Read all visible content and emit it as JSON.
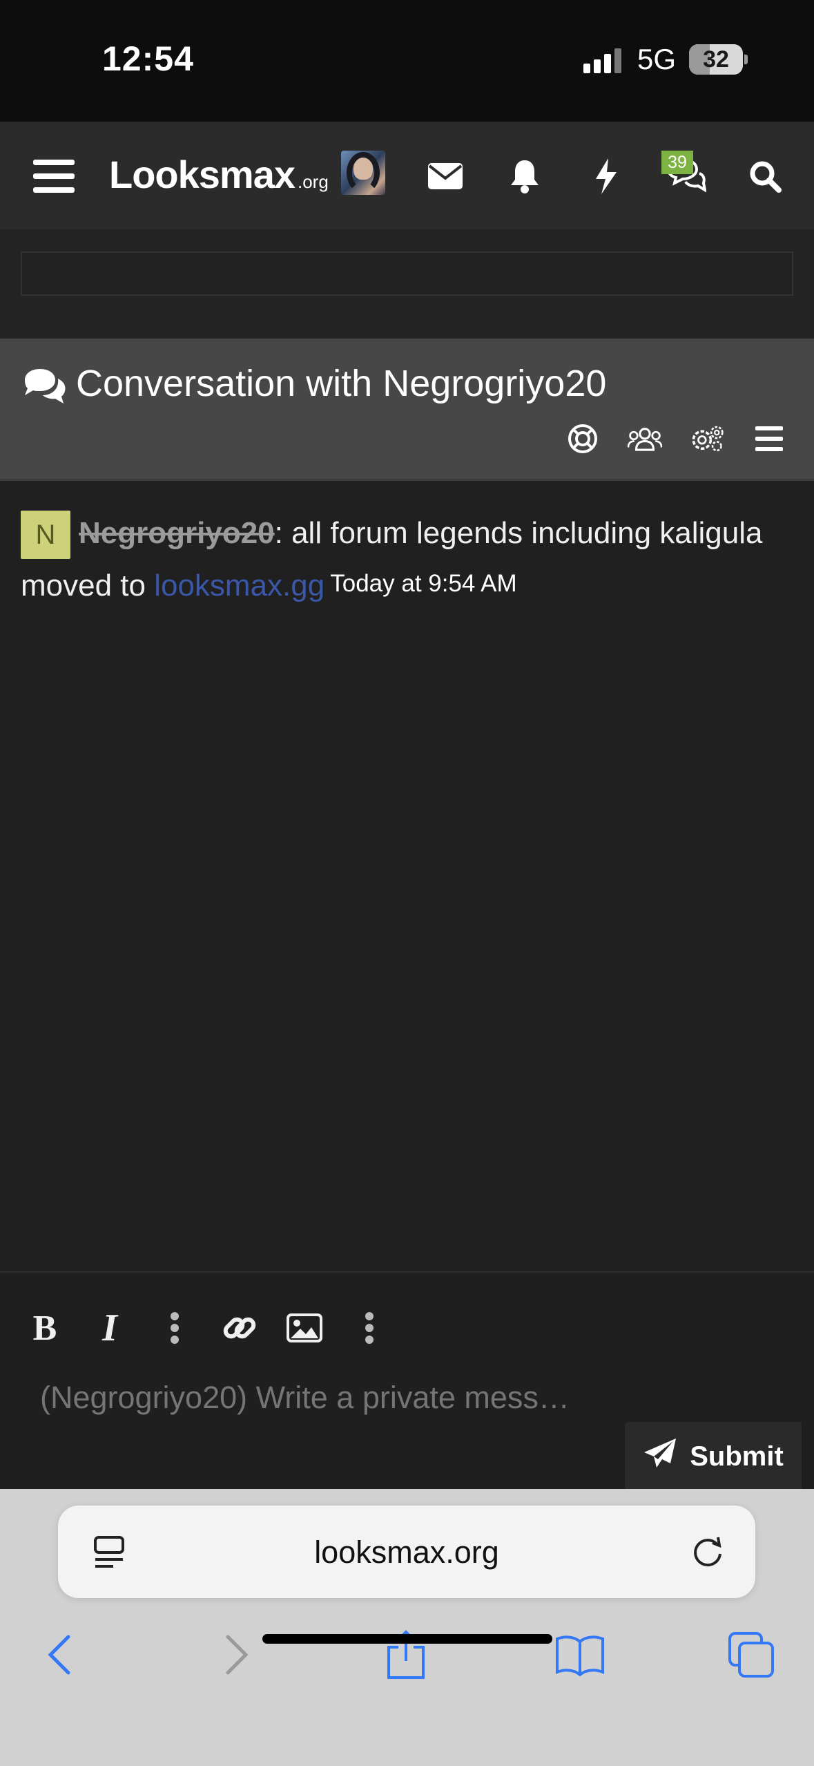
{
  "status_bar": {
    "time": "12:54",
    "network": "5G",
    "battery": "32",
    "battery_level": 0.32
  },
  "header": {
    "logo_main": "Looksmax",
    "logo_suffix": ".org",
    "chat_badge": "39",
    "icons": [
      "menu-icon",
      "avatar",
      "envelope-icon",
      "bell-icon",
      "bolt-icon",
      "chat-icon",
      "search-icon"
    ]
  },
  "conversation": {
    "title": "Conversation with Negrogriyo20",
    "actions": [
      "lifebuoy-icon",
      "users-icon",
      "gears-icon",
      "list-icon"
    ]
  },
  "messages": [
    {
      "avatar_letter": "N",
      "username": "Negrogriyo20",
      "text_before_link": ": all forum legends including kaligula moved to ",
      "link": "looksmax.gg",
      "time": "Today at 9:54 AM"
    }
  ],
  "editor": {
    "placeholder": "(Negrogriyo20) Write a private mess…",
    "bold_label": "B",
    "italic_label": "I",
    "submit_label": "Submit"
  },
  "browser": {
    "url": "looksmax.org"
  },
  "colors": {
    "accent_green": "#7cb342",
    "link_blue": "#3a57a8",
    "safari_blue": "#3478f6"
  }
}
